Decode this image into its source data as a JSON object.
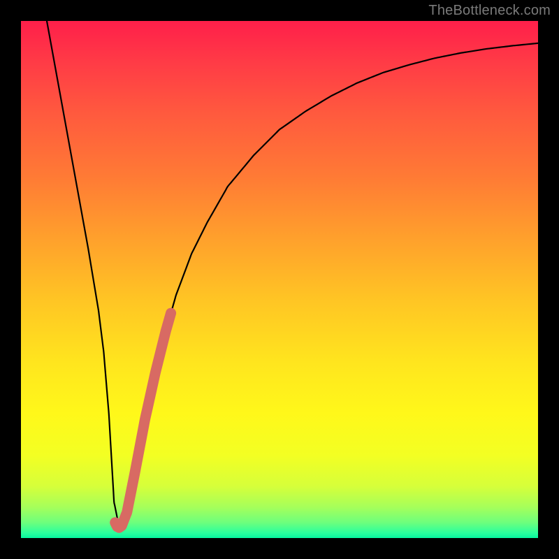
{
  "watermark": "TheBottleneck.com",
  "colors": {
    "frame": "#000000",
    "curve": "#000000",
    "marker": "#d86a63",
    "gradient_top": "#ff1f4a",
    "gradient_bottom": "#07f59f"
  },
  "chart_data": {
    "type": "line",
    "title": "",
    "xlabel": "",
    "ylabel": "",
    "xlim": [
      0,
      100
    ],
    "ylim": [
      0,
      100
    ],
    "series": [
      {
        "name": "bottleneck-curve",
        "x": [
          5,
          7,
          9,
          11,
          13,
          15,
          16,
          17,
          18,
          19,
          20,
          22,
          24,
          26,
          28,
          30,
          33,
          36,
          40,
          45,
          50,
          55,
          60,
          65,
          70,
          75,
          80,
          85,
          90,
          95,
          100
        ],
        "y": [
          100,
          89,
          78,
          67,
          56,
          44,
          36,
          24,
          7,
          2,
          4,
          12,
          22,
          32,
          40,
          47,
          55,
          61,
          68,
          74,
          79,
          82.5,
          85.5,
          88,
          90,
          91.5,
          92.8,
          93.8,
          94.6,
          95.2,
          95.7
        ]
      }
    ],
    "highlight_segment": {
      "name": "marker-overlay",
      "description": "salmon rounded stroke overlaid on curve near minimum, rising right branch",
      "x": [
        18.2,
        18.6,
        19.0,
        19.5,
        20.5,
        22.0,
        24.0,
        26.0,
        28.0,
        29.0
      ],
      "y": [
        3.0,
        2.2,
        2.0,
        2.4,
        5.0,
        12.5,
        23.0,
        32.0,
        40.0,
        43.5
      ]
    },
    "minimum": {
      "x": 19,
      "y": 2
    }
  }
}
